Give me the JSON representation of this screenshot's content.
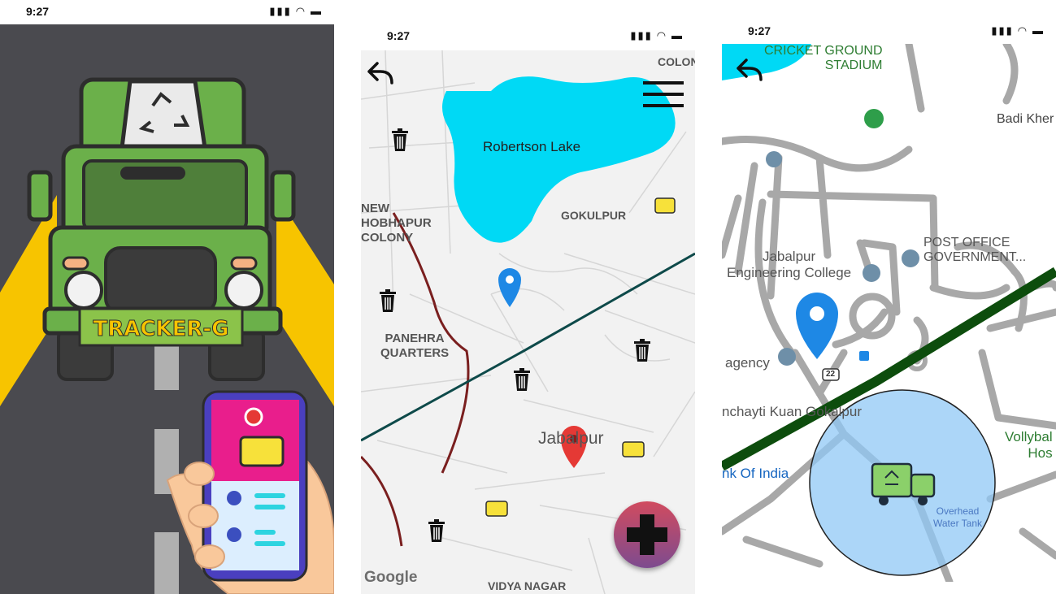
{
  "screens": {
    "splash": {
      "status_time": "9:27",
      "status_icons": "▮▮▮ ◠ ▬",
      "brand_plate": "TRACKER-G",
      "colors": {
        "road": "#4a4a4f",
        "truck": "#6bb04a",
        "lights": "#f7c400",
        "plate": "#8bc34a",
        "plate_text": "#f7c400",
        "phone_screen_top": "#e91e8c"
      }
    },
    "map": {
      "status_time": "9:27",
      "status_icons": "▮▮▮ ◠ ▬",
      "labels": {
        "robertson_lake": "Robertson Lake",
        "new_shobhapur_colony": "NEW\nHOBHAPUR\nCOLONY",
        "gokulpur": "GOKULPUR",
        "panehra_quarters": "PANEHRA\nQUARTERS",
        "jabalpur": "Jabalpur",
        "vidya_nagar": "VIDYA NAGAR",
        "colony_top": "COLON",
        "google": "Google"
      },
      "icons": [
        "back-arrow-icon",
        "menu-icon",
        "trash-bin-icon",
        "garbage-truck-icon",
        "location-pin-icon",
        "add-icon"
      ],
      "colors": {
        "water": "#00d9f5",
        "rail": "#7a1f1f",
        "road_main": "#0e4a4a",
        "pin_blue": "#1e88e5",
        "pin_red": "#e53935",
        "fab_top": "#d14b5f",
        "fab_bottom": "#5a3f8f"
      }
    },
    "detail": {
      "status_time": "9:27",
      "status_icons": "▮▮▮ ◠ ▬",
      "labels": {
        "cricket_ground": "CRICKET GROUND\nSTADIUM",
        "badi_kher": "Badi Kher",
        "jabalpur_engg": "Jabalpur\nEngineering College",
        "post_office": "POST OFFICE\nGOVERNMENT...",
        "agency": "agency",
        "panchayti": "nchayti Kuan Gokalpur",
        "bank_of_india": "nk Of India",
        "vollyball": "Vollybal\nHos",
        "overhead_tank": "Overhead\nWater Tank",
        "road_badge": "22"
      },
      "colors": {
        "road": "#a8a8a8",
        "rail": "#0d4d0d",
        "radius": "#90c8f5",
        "pin_blue": "#1e88e5",
        "green_label": "#2e7d32",
        "blue_label": "#1565c0"
      }
    }
  }
}
